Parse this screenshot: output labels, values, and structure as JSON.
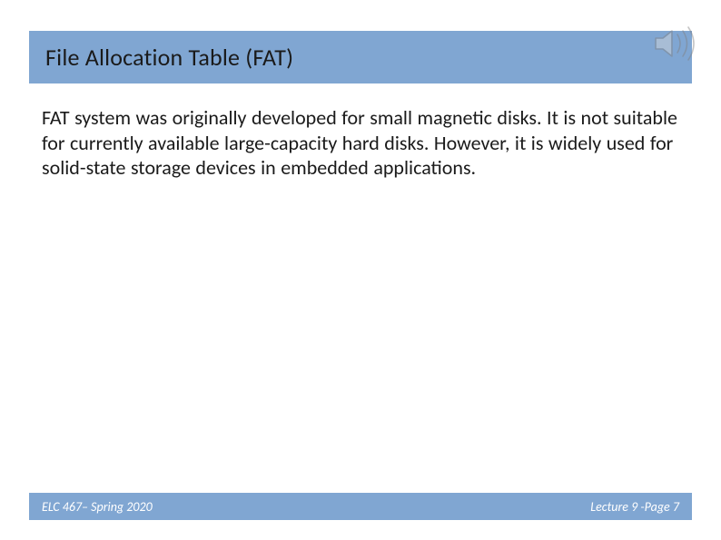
{
  "title": "File Allocation Table (FAT)",
  "body": "FAT system was originally developed for small magnetic disks.  It is not suitable for currently available large-capacity hard disks.  However, it is widely used for solid-state storage devices in embedded applications.",
  "footer": {
    "left": "ELC 467– Spring 2020",
    "right": "Lecture 9 -Page 7"
  },
  "icon": "speaker-icon"
}
